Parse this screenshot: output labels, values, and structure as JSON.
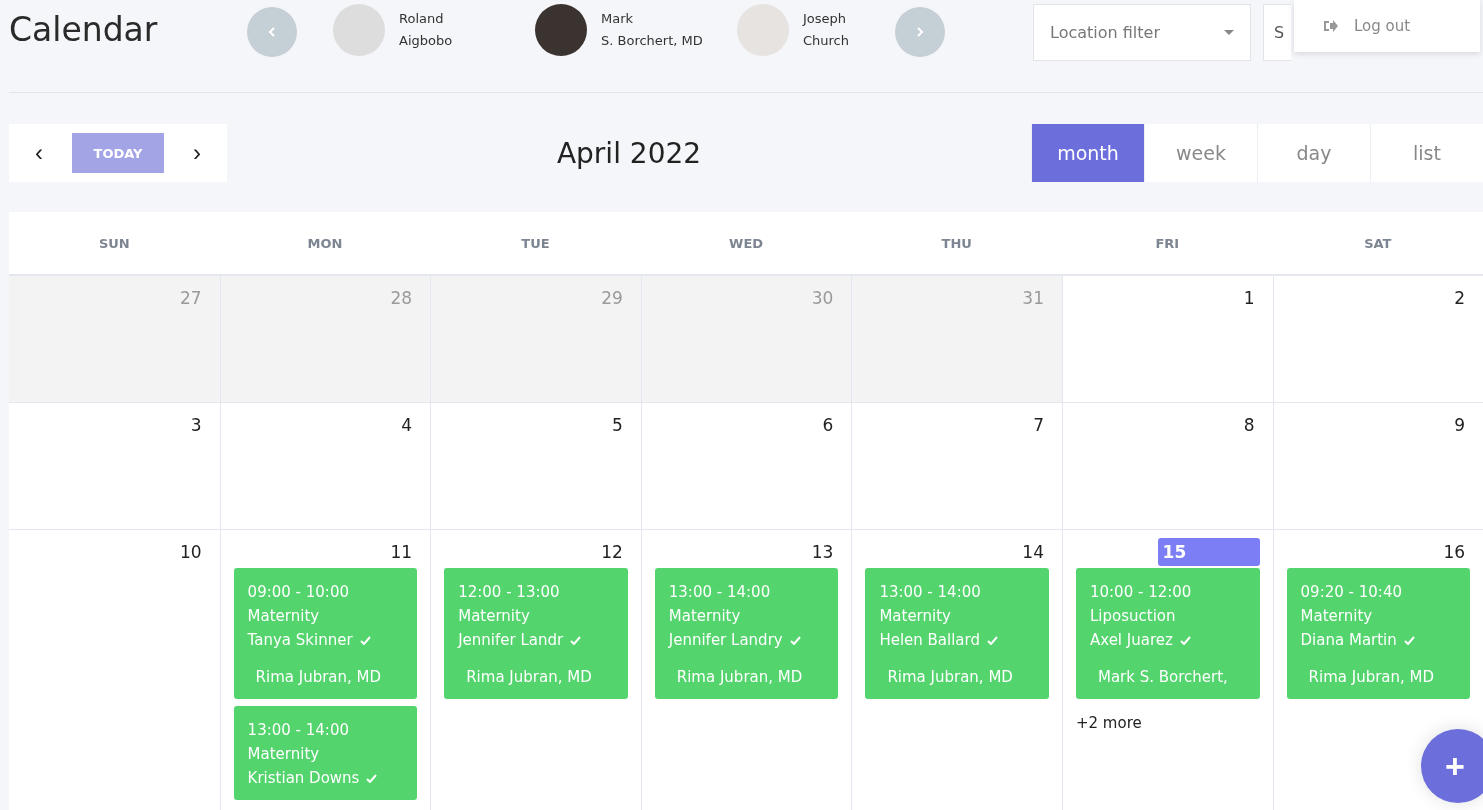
{
  "title": "Calendar",
  "doctors": [
    {
      "first": "Roland",
      "last": "Aigbobo"
    },
    {
      "first": "Mark",
      "last": "S. Borchert, MD"
    },
    {
      "first": "Joseph",
      "last": "Church"
    }
  ],
  "location_filter": {
    "placeholder": "Location filter"
  },
  "second_filter": {
    "placeholder": "S"
  },
  "user_menu": {
    "items": [
      "Log out"
    ]
  },
  "toolbar": {
    "today": {
      "label": "TODAY",
      "disabled": true
    },
    "prev": "‹",
    "next": "›",
    "period": "April 2022",
    "views": [
      {
        "label": "month",
        "selected": true
      },
      {
        "label": "week",
        "selected": false
      },
      {
        "label": "day",
        "selected": false
      },
      {
        "label": "list",
        "selected": false
      }
    ]
  },
  "weekdays": [
    "SUN",
    "MON",
    "TUE",
    "WED",
    "THU",
    "FRI",
    "SAT"
  ],
  "weeks": [
    [
      {
        "day": "27",
        "other_month": true
      },
      {
        "day": "28",
        "other_month": true
      },
      {
        "day": "29",
        "other_month": true
      },
      {
        "day": "30",
        "other_month": true
      },
      {
        "day": "31",
        "other_month": true
      },
      {
        "day": "1",
        "other_month": false
      },
      {
        "day": "2",
        "other_month": false
      }
    ],
    [
      {
        "day": "3",
        "other_month": false
      },
      {
        "day": "4",
        "other_month": false
      },
      {
        "day": "5",
        "other_month": false
      },
      {
        "day": "6",
        "other_month": false
      },
      {
        "day": "7",
        "other_month": false
      },
      {
        "day": "8",
        "other_month": false
      },
      {
        "day": "9",
        "other_month": false
      }
    ],
    [
      {
        "day": "10",
        "other_month": false
      },
      {
        "day": "11",
        "other_month": false,
        "events": [
          {
            "time": "09:00 - 10:00",
            "type": "Maternity",
            "patient": "Tanya Skinner",
            "confirmed": true,
            "doctor": "Rima Jubran, MD"
          },
          {
            "time": "13:00 - 14:00",
            "type": "Maternity",
            "patient": "Kristian Downs",
            "confirmed": true
          }
        ]
      },
      {
        "day": "12",
        "other_month": false,
        "events": [
          {
            "time": "12:00 - 13:00",
            "type": "Maternity",
            "patient": "Jennifer Landr",
            "confirmed": true,
            "doctor": "Rima Jubran, MD"
          }
        ]
      },
      {
        "day": "13",
        "other_month": false,
        "events": [
          {
            "time": "13:00 - 14:00",
            "type": "Maternity",
            "patient": "Jennifer Landry",
            "confirmed": true,
            "doctor": "Rima Jubran, MD"
          }
        ]
      },
      {
        "day": "14",
        "other_month": false,
        "events": [
          {
            "time": "13:00 - 14:00",
            "type": "Maternity",
            "patient": "Helen Ballard",
            "confirmed": true,
            "doctor": "Rima Jubran, MD"
          }
        ]
      },
      {
        "day": "15",
        "other_month": false,
        "today": true,
        "events": [
          {
            "time": "10:00 - 12:00",
            "type": "Liposuction",
            "patient": "Axel Juarez",
            "confirmed": true,
            "doctor": "Mark S. Borchert,"
          }
        ],
        "more": "+2 more"
      },
      {
        "day": "16",
        "other_month": false,
        "events": [
          {
            "time": "09:20 - 10:40",
            "type": "Maternity",
            "patient": "Diana Martin",
            "confirmed": true,
            "doctor": "Rima Jubran, MD"
          }
        ]
      }
    ]
  ],
  "fab": {
    "label": "+"
  }
}
